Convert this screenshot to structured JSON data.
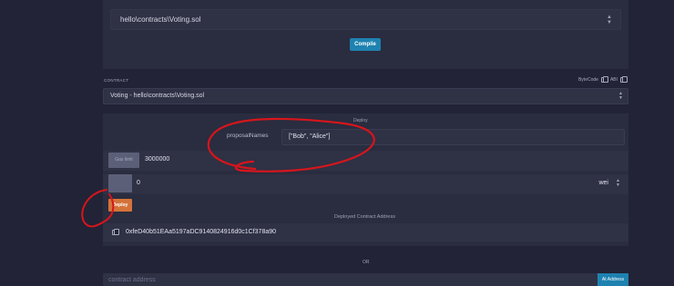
{
  "compiler": {
    "file_path": "hello\\contracts\\Voting.sol",
    "compile_label": "Compile"
  },
  "contract_section": {
    "section_label": "CONTRACT",
    "bytecode_label": "ByteCode",
    "abi_label": "ABI",
    "selected_contract": "Voting - hello\\contracts\\Voting.sol"
  },
  "deploy": {
    "header": "Deploy",
    "param_label": "proposalNames",
    "param_value": "[\"Bob\", \"Alice\"]",
    "gas_limit_label": "Gas limit",
    "gas_limit_value": "3000000",
    "value_amount": "0",
    "value_unit": "wei",
    "deploy_label": "Deploy",
    "deployed_address_label": "Deployed Contract Address",
    "deployed_address": "0xfeD40b51EAa5197aDC9140824916d0c1Cf378a90"
  },
  "at_address": {
    "or_label": "OR",
    "placeholder": "contract address",
    "button_label": "At Address"
  },
  "icons": {
    "chevron": "chevron-updown-icon",
    "copy": "copy-icon"
  },
  "colors": {
    "background": "#222336",
    "card": "#2a2c3f",
    "input": "#2f3145",
    "primary_button": "#1e82b0",
    "deploy_button": "#d4733a",
    "annotation_red": "#d8151b"
  }
}
